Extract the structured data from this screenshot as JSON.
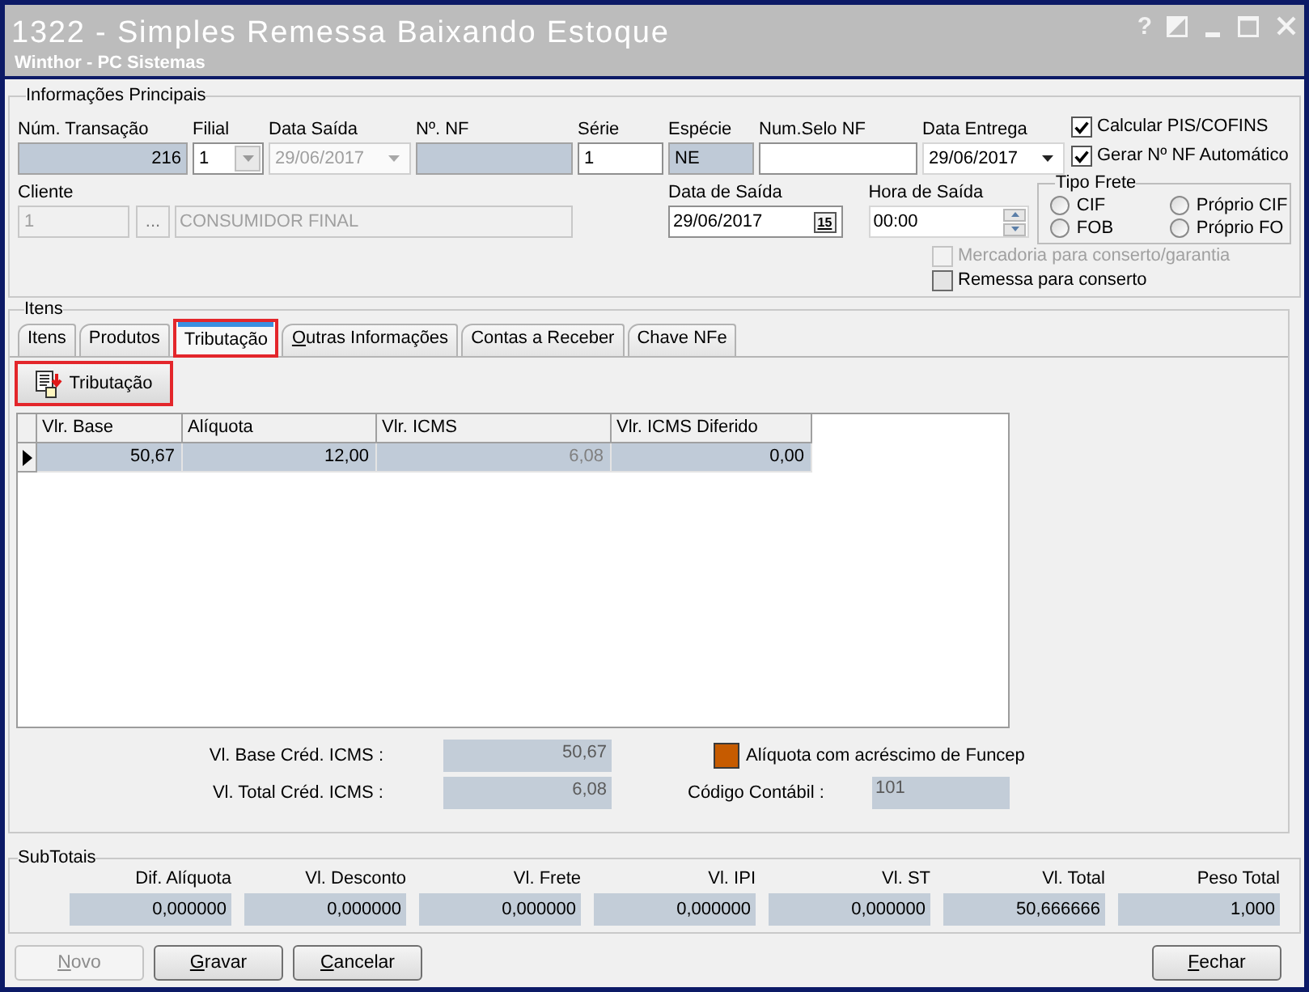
{
  "window": {
    "title": "1322 - Simples Remessa Baixando Estoque",
    "subtitle": "Winthor - PC Sistemas",
    "help_glyph": "?"
  },
  "main_info": {
    "title": "Informações Principais",
    "fields": [
      {
        "label": "Núm. Transação",
        "kind": "number",
        "value": "216",
        "disabled": false
      },
      {
        "label": "Filial",
        "kind": "combo",
        "value": "1",
        "disabled": false
      },
      {
        "label": "Data Saída",
        "kind": "date_combo",
        "value": "29/06/2017",
        "disabled": true
      },
      {
        "label": "Nº. NF",
        "kind": "readonly",
        "disabled": false
      },
      {
        "label": "Série",
        "kind": "text",
        "value": "1",
        "disabled": false
      },
      {
        "label": "Espécie",
        "kind": "readonly",
        "value": "NE",
        "disabled": false
      },
      {
        "label": "Num.Selo NF",
        "kind": "text",
        "disabled": false
      },
      {
        "label": "Data Entrega",
        "kind": "date_combo",
        "value": "29/06/2017",
        "disabled": false
      }
    ],
    "options_top": [
      {
        "label": "Calcular PIS/COFINS",
        "checked": true,
        "disabled": false
      },
      {
        "label": "Gerar Nº NF Automático",
        "checked": true,
        "disabled": false
      }
    ],
    "client": {
      "label": "Cliente",
      "code": "1",
      "lookup_glyph": "...",
      "name": "CONSUMIDOR FINAL",
      "disabled": true
    },
    "exit_date": {
      "label": "Data de Saída",
      "value": "29/06/2017",
      "calendar_glyph": "15"
    },
    "exit_time": {
      "label": "Hora de Saída",
      "value": "00:00"
    },
    "freight_type": {
      "title": "Tipo Frete",
      "options": [
        {
          "label": "CIF",
          "selected": false
        },
        {
          "label": "Próprio CIF",
          "selected": false
        },
        {
          "label": "FOB",
          "selected": false
        },
        {
          "label": "Próprio FO",
          "selected": false
        }
      ]
    },
    "options_bottom": [
      {
        "label": "Mercadoria para conserto/garantia",
        "checked": false,
        "disabled": true
      },
      {
        "label": "Remessa para conserto",
        "checked": false,
        "disabled": false
      }
    ]
  },
  "items": {
    "title": "Itens",
    "tabs": [
      {
        "label": "Itens",
        "selected": false,
        "highlighted": false,
        "access_key": false
      },
      {
        "label": "Produtos",
        "selected": false,
        "highlighted": false,
        "access_key": false
      },
      {
        "label": "Tributação",
        "selected": true,
        "highlighted": true,
        "access_key": false
      },
      {
        "label": "Outras Informações",
        "selected": false,
        "highlighted": false,
        "access_key": true
      },
      {
        "label": "Contas a Receber",
        "selected": false,
        "highlighted": false,
        "access_key": false
      },
      {
        "label": "Chave NFe",
        "selected": false,
        "highlighted": false,
        "access_key": false
      }
    ],
    "action_button": {
      "label": "Tributação",
      "highlighted": true
    },
    "grid": {
      "columns": [
        {
          "label": "Vlr. Base",
          "disabled": false
        },
        {
          "label": "Alíquota",
          "disabled": false
        },
        {
          "label": "Vlr. ICMS",
          "disabled": true
        },
        {
          "label": "Vlr. ICMS Diferido",
          "disabled": false
        }
      ],
      "rows": [
        {
          "selected": true,
          "cells": [
            "50,67",
            "12,00",
            "6,08",
            "0,00"
          ]
        }
      ]
    },
    "credit_fields": [
      {
        "label": "Vl. Base Créd. ICMS :",
        "value": "50,67"
      },
      {
        "label": "Vl. Total Créd. ICMS :",
        "value": "6,08"
      }
    ],
    "funcep_legend": {
      "label": "Alíquota com acréscimo de Funcep"
    },
    "accounting_code": {
      "label": "Código Contábil :",
      "value": "101"
    }
  },
  "subtotals": {
    "title": "SubTotais",
    "items": [
      {
        "label": "Dif. Alíquota",
        "value": "0,000000"
      },
      {
        "label": "Vl. Desconto",
        "value": "0,000000"
      },
      {
        "label": "Vl. Frete",
        "value": "0,000000"
      },
      {
        "label": "Vl. IPI",
        "value": "0,000000"
      },
      {
        "label": "Vl. ST",
        "value": "0,000000"
      },
      {
        "label": "Vl. Total",
        "value": "50,666666"
      },
      {
        "label": "Peso Total",
        "value": "1,000"
      }
    ]
  },
  "buttons": [
    {
      "label": "Novo",
      "disabled": true,
      "access_key": true
    },
    {
      "label": "Gravar",
      "disabled": false,
      "access_key": true
    },
    {
      "label": "Cancelar",
      "disabled": false,
      "access_key": true
    }
  ],
  "close_button": {
    "label": "Fechar",
    "disabled": false,
    "access_key": true
  }
}
